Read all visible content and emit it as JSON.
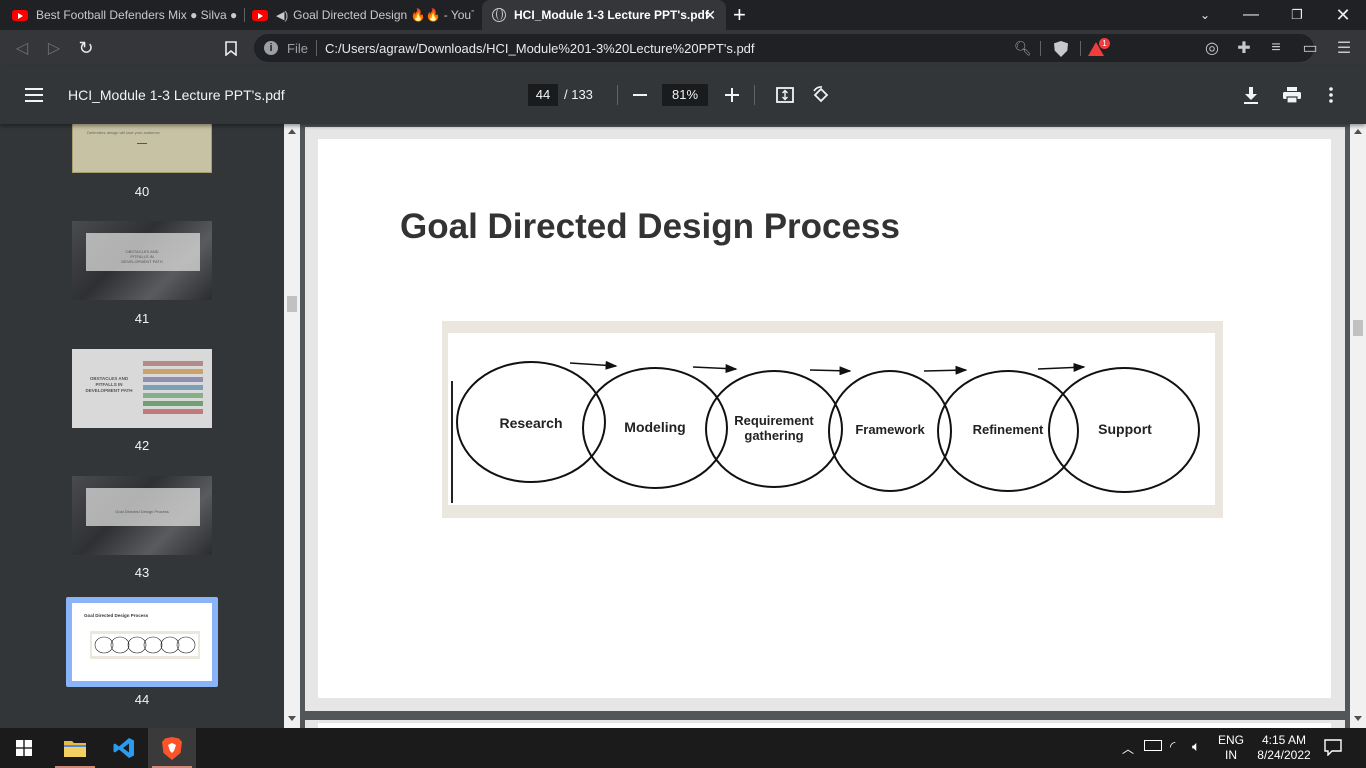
{
  "browser": {
    "tabs": [
      {
        "label": "Best Football Defenders Mix ● Silva ●",
        "icon": "youtube-icon",
        "active": false
      },
      {
        "label": "Goal Directed Design 🔥🔥 - YouTube",
        "icon": "youtube-icon",
        "active": false
      },
      {
        "label": "HCI_Module 1-3 Lecture PPT's.pdf",
        "icon": "globe-icon",
        "active": true
      }
    ],
    "new_tab": "+",
    "address": {
      "scheme_label": "File",
      "url": "C:/Users/agraw/Downloads/HCI_Module%201-3%20Lecture%20PPT's.pdf"
    },
    "rewards_badge": "1"
  },
  "pdf": {
    "title": "HCI_Module 1-3 Lecture PPT's.pdf",
    "current_page": "44",
    "total_pages": "/ 133",
    "zoom": "81%"
  },
  "sidebar": {
    "thumbnails": [
      {
        "page": "40",
        "text": "Defenders design will lose your audience"
      },
      {
        "page": "41",
        "text": "OBSTACLES AND PITFALLS IN DEVELOPMENT PATH"
      },
      {
        "page": "42",
        "text": "OBSTACLES AND PITFALLS IN DEVELOPMENT PATH"
      },
      {
        "page": "43",
        "text": "Goal Directed Design Process"
      },
      {
        "page": "44",
        "text": "Goal Directed Design Process",
        "selected": true
      }
    ]
  },
  "slide": {
    "title": "Goal Directed Design Process",
    "steps": [
      "Research",
      "Modeling",
      "Requirement gathering",
      "Framework",
      "Refinement",
      "Support"
    ]
  },
  "taskbar": {
    "apps": [
      "file-explorer-icon",
      "vscode-icon",
      "brave-icon"
    ],
    "language": "ENG",
    "region": "IN",
    "time": "4:15 AM",
    "date": "8/24/2022"
  },
  "colors": {
    "accent": "#8ab4f8",
    "brave_orange": "#fb542b",
    "youtube_red": "#ff0000"
  }
}
